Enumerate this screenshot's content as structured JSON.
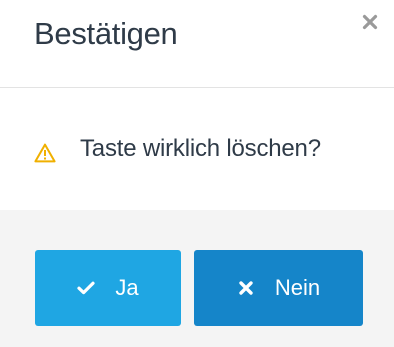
{
  "dialog": {
    "title": "Bestätigen",
    "close_icon": "close-icon",
    "warning_icon": "warning-triangle-icon",
    "message": "Taste wirklich löschen?",
    "buttons": {
      "yes": {
        "label": "Ja",
        "icon": "check-icon",
        "color": "#1fa6e3"
      },
      "no": {
        "label": "Nein",
        "icon": "close-icon",
        "color": "#1585c9"
      }
    },
    "colors": {
      "title_text": "#2f3b48",
      "warning": "#f0b000",
      "footer_bg": "#f4f4f4"
    }
  }
}
